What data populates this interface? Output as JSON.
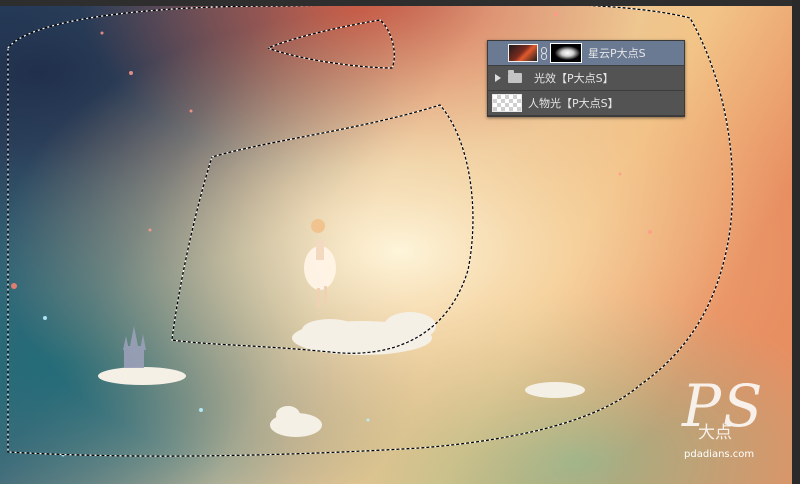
{
  "layers_panel": {
    "layers": [
      {
        "name": "星云P大点S",
        "selected": true,
        "thumbnail": "image-with-mask"
      },
      {
        "name": "光效【P大点S】",
        "type": "group",
        "collapsed": true
      },
      {
        "name": "人物光【P大点S】",
        "thumbnail": "transparent"
      }
    ]
  },
  "icons": {
    "chain": "link-icon",
    "disclosure": "triangle-right-icon",
    "group": "folder-icon"
  },
  "watermark": {
    "logo": "Ps大点",
    "url": "pdadians.com"
  },
  "canvas": {
    "selection": "marching-ants"
  },
  "colors": {
    "panel_bg": "#535353",
    "selected_row": "#6b7a93",
    "panel_text": "#e6e6e6",
    "frame": "#2e2e2e"
  }
}
